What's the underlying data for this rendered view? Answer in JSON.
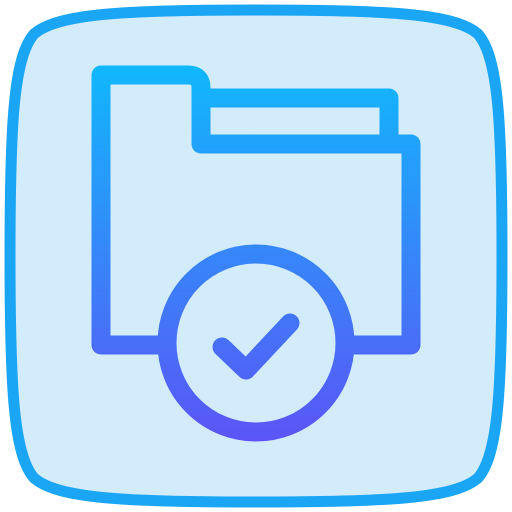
{
  "icon": {
    "name": "folder-check-icon",
    "colors": {
      "tile_fill": "#D3ECFB",
      "tile_stroke": "#1AA5F5",
      "gradient_top": "#10B8FC",
      "gradient_bottom": "#5B55F7"
    }
  }
}
